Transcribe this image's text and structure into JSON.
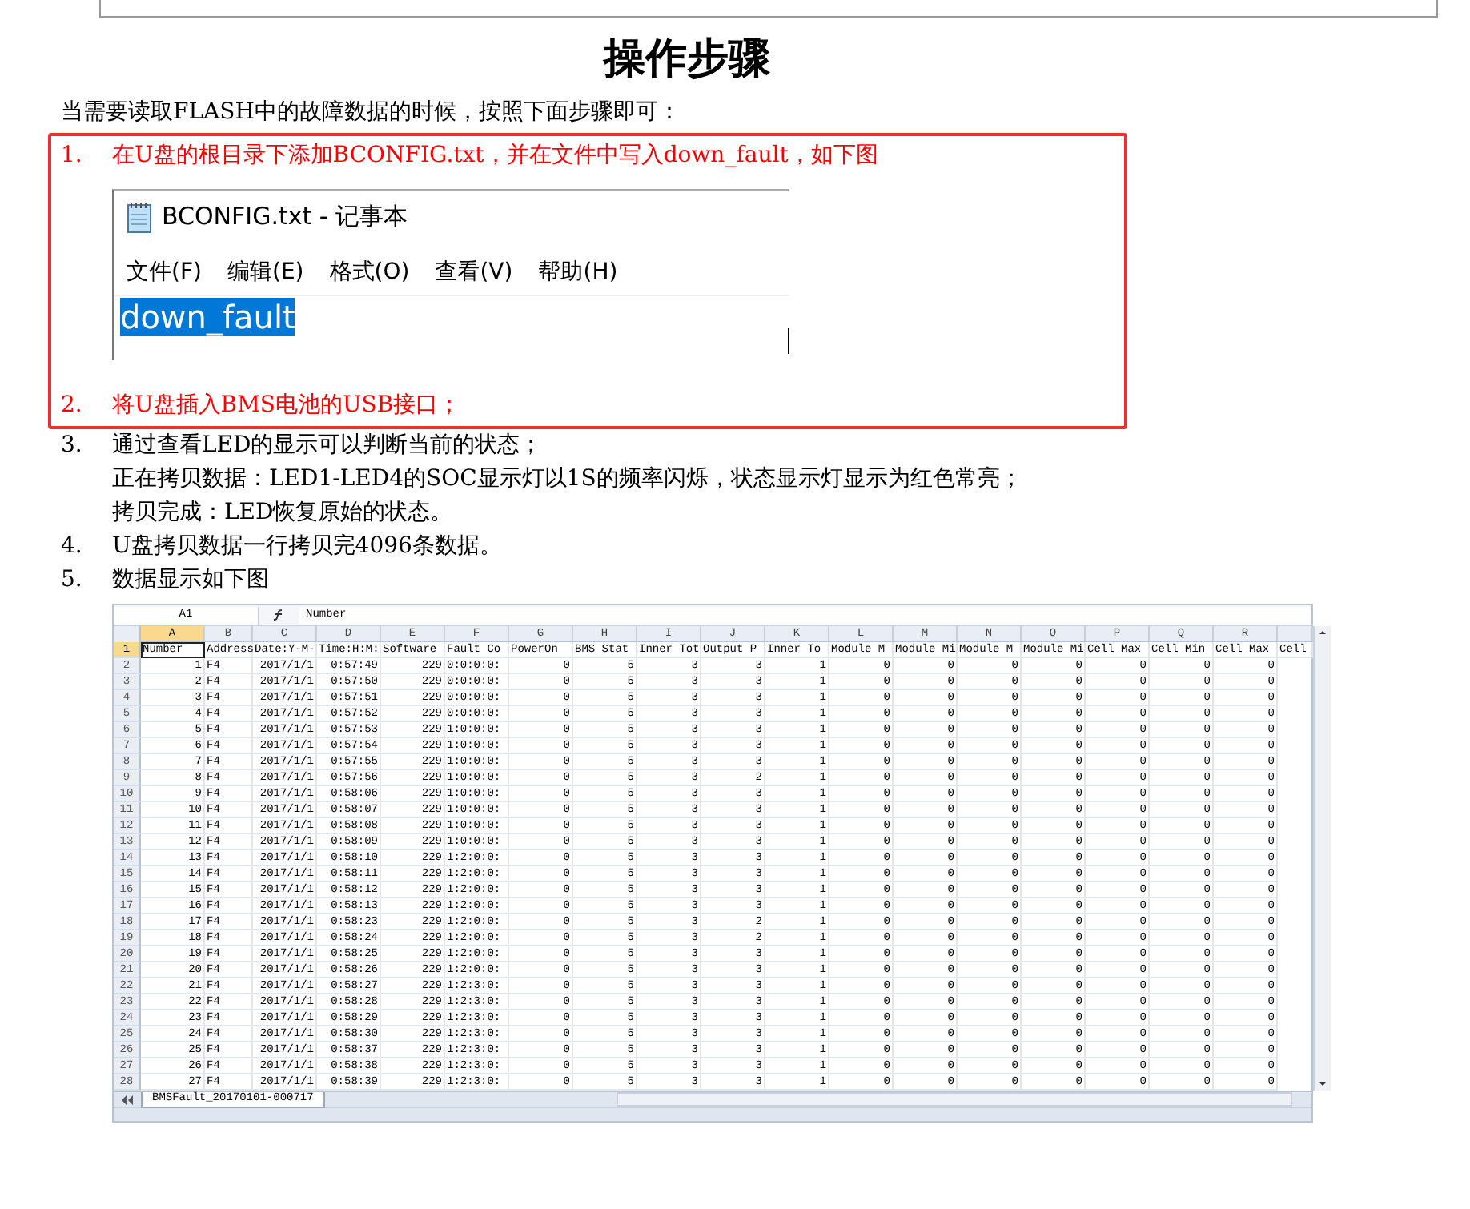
{
  "title": "操作步骤",
  "intro": "当需要读取FLASH中的故障数据的时候，按照下面步骤即可：",
  "steps": [
    {
      "number": "1.",
      "text": "在U盘的根目录下添加BCONFIG.txt，并在文件中写入down_fault，如下图",
      "highlighted": true,
      "notepad": {
        "title": "BCONFIG.txt - 记事本",
        "menu": [
          "文件(F)",
          "编辑(E)",
          "格式(O)",
          "查看(V)",
          "帮助(H)"
        ],
        "content": "down_fault",
        "content_selected": true
      }
    },
    {
      "number": "2.",
      "text": "将U盘插入BMS电池的USB接口；",
      "highlighted": true
    },
    {
      "number": "3.",
      "text": "通过查看LED的显示可以判断当前的状态；",
      "highlighted": false,
      "lines": [
        "正在拷贝数据：LED1-LED4的SOC显示灯以1S的频率闪烁，状态显示灯显示为红色常亮；",
        "拷贝完成：LED恢复原始的状态。"
      ]
    },
    {
      "number": "4.",
      "text": "U盘拷贝数据一行拷贝完4096条数据。",
      "highlighted": false
    },
    {
      "number": "5.",
      "text": "数据显示如下图",
      "highlighted": false,
      "spreadsheet": {
        "name_box": "A1",
        "formula": "Number",
        "sheet_tab": "BMSFault_20170101-000717",
        "columns": [
          {
            "letter": "A",
            "selected": true
          },
          {
            "letter": "B",
            "selected": false
          },
          {
            "letter": "C",
            "selected": false
          },
          {
            "letter": "D",
            "selected": false
          },
          {
            "letter": "E",
            "selected": false
          },
          {
            "letter": "F",
            "selected": false
          },
          {
            "letter": "G",
            "selected": false
          },
          {
            "letter": "H",
            "selected": false
          },
          {
            "letter": "I",
            "selected": false
          },
          {
            "letter": "J",
            "selected": false
          },
          {
            "letter": "K",
            "selected": false
          },
          {
            "letter": "L",
            "selected": false
          },
          {
            "letter": "M",
            "selected": false
          },
          {
            "letter": "N",
            "selected": false
          },
          {
            "letter": "O",
            "selected": false
          },
          {
            "letter": "P",
            "selected": false
          },
          {
            "letter": "Q",
            "selected": false
          },
          {
            "letter": "R",
            "selected": false
          },
          {
            "selected": false
          }
        ],
        "rows": [
          {
            "label": "1",
            "kind": "header",
            "selected": true,
            "cells": [
              "Number",
              "Address",
              "Date:Y-M-",
              "Time:H:M:",
              "Software",
              "Fault Co",
              "PowerOn",
              "BMS Stat",
              "Inner Tot",
              "Output P",
              "Inner To",
              "Module M",
              "Module Mi",
              "Module M",
              "Module Mi",
              "Cell Max",
              "Cell Min",
              "Cell Max",
              "Cell"
            ]
          },
          {
            "label": "2",
            "kind": "data",
            "selected": false,
            "cells": [
              "1",
              "F4",
              "2017/1/1",
              "0:57:49",
              "229",
              "0:0:0:0:",
              "0",
              "5",
              "3",
              "3",
              "1",
              "0",
              "0",
              "0",
              "0",
              "0",
              "0",
              "0"
            ]
          },
          {
            "label": "3",
            "kind": "data",
            "selected": false,
            "cells": [
              "2",
              "F4",
              "2017/1/1",
              "0:57:50",
              "229",
              "0:0:0:0:",
              "0",
              "5",
              "3",
              "3",
              "1",
              "0",
              "0",
              "0",
              "0",
              "0",
              "0",
              "0"
            ]
          },
          {
            "label": "4",
            "kind": "data",
            "selected": false,
            "cells": [
              "3",
              "F4",
              "2017/1/1",
              "0:57:51",
              "229",
              "0:0:0:0:",
              "0",
              "5",
              "3",
              "3",
              "1",
              "0",
              "0",
              "0",
              "0",
              "0",
              "0",
              "0"
            ]
          },
          {
            "label": "5",
            "kind": "data",
            "selected": false,
            "cells": [
              "4",
              "F4",
              "2017/1/1",
              "0:57:52",
              "229",
              "0:0:0:0:",
              "0",
              "5",
              "3",
              "3",
              "1",
              "0",
              "0",
              "0",
              "0",
              "0",
              "0",
              "0"
            ]
          },
          {
            "label": "6",
            "kind": "data",
            "selected": false,
            "cells": [
              "5",
              "F4",
              "2017/1/1",
              "0:57:53",
              "229",
              "1:0:0:0:",
              "0",
              "5",
              "3",
              "3",
              "1",
              "0",
              "0",
              "0",
              "0",
              "0",
              "0",
              "0"
            ]
          },
          {
            "label": "7",
            "kind": "data",
            "selected": false,
            "cells": [
              "6",
              "F4",
              "2017/1/1",
              "0:57:54",
              "229",
              "1:0:0:0:",
              "0",
              "5",
              "3",
              "3",
              "1",
              "0",
              "0",
              "0",
              "0",
              "0",
              "0",
              "0"
            ]
          },
          {
            "label": "8",
            "kind": "data",
            "selected": false,
            "cells": [
              "7",
              "F4",
              "2017/1/1",
              "0:57:55",
              "229",
              "1:0:0:0:",
              "0",
              "5",
              "3",
              "3",
              "1",
              "0",
              "0",
              "0",
              "0",
              "0",
              "0",
              "0"
            ]
          },
          {
            "label": "9",
            "kind": "data",
            "selected": false,
            "cells": [
              "8",
              "F4",
              "2017/1/1",
              "0:57:56",
              "229",
              "1:0:0:0:",
              "0",
              "5",
              "3",
              "2",
              "1",
              "0",
              "0",
              "0",
              "0",
              "0",
              "0",
              "0"
            ]
          },
          {
            "label": "10",
            "kind": "data",
            "selected": false,
            "cells": [
              "9",
              "F4",
              "2017/1/1",
              "0:58:06",
              "229",
              "1:0:0:0:",
              "0",
              "5",
              "3",
              "3",
              "1",
              "0",
              "0",
              "0",
              "0",
              "0",
              "0",
              "0"
            ]
          },
          {
            "label": "11",
            "kind": "data",
            "selected": false,
            "cells": [
              "10",
              "F4",
              "2017/1/1",
              "0:58:07",
              "229",
              "1:0:0:0:",
              "0",
              "5",
              "3",
              "3",
              "1",
              "0",
              "0",
              "0",
              "0",
              "0",
              "0",
              "0"
            ]
          },
          {
            "label": "12",
            "kind": "data",
            "selected": false,
            "cells": [
              "11",
              "F4",
              "2017/1/1",
              "0:58:08",
              "229",
              "1:0:0:0:",
              "0",
              "5",
              "3",
              "3",
              "1",
              "0",
              "0",
              "0",
              "0",
              "0",
              "0",
              "0"
            ]
          },
          {
            "label": "13",
            "kind": "data",
            "selected": false,
            "cells": [
              "12",
              "F4",
              "2017/1/1",
              "0:58:09",
              "229",
              "1:0:0:0:",
              "0",
              "5",
              "3",
              "3",
              "1",
              "0",
              "0",
              "0",
              "0",
              "0",
              "0",
              "0"
            ]
          },
          {
            "label": "14",
            "kind": "data",
            "selected": false,
            "cells": [
              "13",
              "F4",
              "2017/1/1",
              "0:58:10",
              "229",
              "1:2:0:0:",
              "0",
              "5",
              "3",
              "3",
              "1",
              "0",
              "0",
              "0",
              "0",
              "0",
              "0",
              "0"
            ]
          },
          {
            "label": "15",
            "kind": "data",
            "selected": false,
            "cells": [
              "14",
              "F4",
              "2017/1/1",
              "0:58:11",
              "229",
              "1:2:0:0:",
              "0",
              "5",
              "3",
              "3",
              "1",
              "0",
              "0",
              "0",
              "0",
              "0",
              "0",
              "0"
            ]
          },
          {
            "label": "16",
            "kind": "data",
            "selected": false,
            "cells": [
              "15",
              "F4",
              "2017/1/1",
              "0:58:12",
              "229",
              "1:2:0:0:",
              "0",
              "5",
              "3",
              "3",
              "1",
              "0",
              "0",
              "0",
              "0",
              "0",
              "0",
              "0"
            ]
          },
          {
            "label": "17",
            "kind": "data",
            "selected": false,
            "cells": [
              "16",
              "F4",
              "2017/1/1",
              "0:58:13",
              "229",
              "1:2:0:0:",
              "0",
              "5",
              "3",
              "3",
              "1",
              "0",
              "0",
              "0",
              "0",
              "0",
              "0",
              "0"
            ]
          },
          {
            "label": "18",
            "kind": "data",
            "selected": false,
            "cells": [
              "17",
              "F4",
              "2017/1/1",
              "0:58:23",
              "229",
              "1:2:0:0:",
              "0",
              "5",
              "3",
              "2",
              "1",
              "0",
              "0",
              "0",
              "0",
              "0",
              "0",
              "0"
            ]
          },
          {
            "label": "19",
            "kind": "data",
            "selected": false,
            "cells": [
              "18",
              "F4",
              "2017/1/1",
              "0:58:24",
              "229",
              "1:2:0:0:",
              "0",
              "5",
              "3",
              "2",
              "1",
              "0",
              "0",
              "0",
              "0",
              "0",
              "0",
              "0"
            ]
          },
          {
            "label": "20",
            "kind": "data",
            "selected": false,
            "cells": [
              "19",
              "F4",
              "2017/1/1",
              "0:58:25",
              "229",
              "1:2:0:0:",
              "0",
              "5",
              "3",
              "3",
              "1",
              "0",
              "0",
              "0",
              "0",
              "0",
              "0",
              "0"
            ]
          },
          {
            "label": "21",
            "kind": "data",
            "selected": false,
            "cells": [
              "20",
              "F4",
              "2017/1/1",
              "0:58:26",
              "229",
              "1:2:0:0:",
              "0",
              "5",
              "3",
              "3",
              "1",
              "0",
              "0",
              "0",
              "0",
              "0",
              "0",
              "0"
            ]
          },
          {
            "label": "22",
            "kind": "data",
            "selected": false,
            "cells": [
              "21",
              "F4",
              "2017/1/1",
              "0:58:27",
              "229",
              "1:2:3:0:",
              "0",
              "5",
              "3",
              "3",
              "1",
              "0",
              "0",
              "0",
              "0",
              "0",
              "0",
              "0"
            ]
          },
          {
            "label": "23",
            "kind": "data",
            "selected": false,
            "cells": [
              "22",
              "F4",
              "2017/1/1",
              "0:58:28",
              "229",
              "1:2:3:0:",
              "0",
              "5",
              "3",
              "3",
              "1",
              "0",
              "0",
              "0",
              "0",
              "0",
              "0",
              "0"
            ]
          },
          {
            "label": "24",
            "kind": "data",
            "selected": false,
            "cells": [
              "23",
              "F4",
              "2017/1/1",
              "0:58:29",
              "229",
              "1:2:3:0:",
              "0",
              "5",
              "3",
              "3",
              "1",
              "0",
              "0",
              "0",
              "0",
              "0",
              "0",
              "0"
            ]
          },
          {
            "label": "25",
            "kind": "data",
            "selected": false,
            "cells": [
              "24",
              "F4",
              "2017/1/1",
              "0:58:30",
              "229",
              "1:2:3:0:",
              "0",
              "5",
              "3",
              "3",
              "1",
              "0",
              "0",
              "0",
              "0",
              "0",
              "0",
              "0"
            ]
          },
          {
            "label": "26",
            "kind": "data",
            "selected": false,
            "cells": [
              "25",
              "F4",
              "2017/1/1",
              "0:58:37",
              "229",
              "1:2:3:0:",
              "0",
              "5",
              "3",
              "3",
              "1",
              "0",
              "0",
              "0",
              "0",
              "0",
              "0",
              "0"
            ]
          },
          {
            "label": "27",
            "kind": "data",
            "selected": false,
            "cells": [
              "26",
              "F4",
              "2017/1/1",
              "0:58:38",
              "229",
              "1:2:3:0:",
              "0",
              "5",
              "3",
              "3",
              "1",
              "0",
              "0",
              "0",
              "0",
              "0",
              "0",
              "0"
            ]
          },
          {
            "label": "28",
            "kind": "data",
            "selected": false,
            "cells": [
              "27",
              "F4",
              "2017/1/1",
              "0:58:39",
              "229",
              "1:2:3:0:",
              "0",
              "5",
              "3",
              "3",
              "1",
              "0",
              "0",
              "0",
              "0",
              "0",
              "0",
              "0"
            ]
          }
        ]
      }
    }
  ]
}
